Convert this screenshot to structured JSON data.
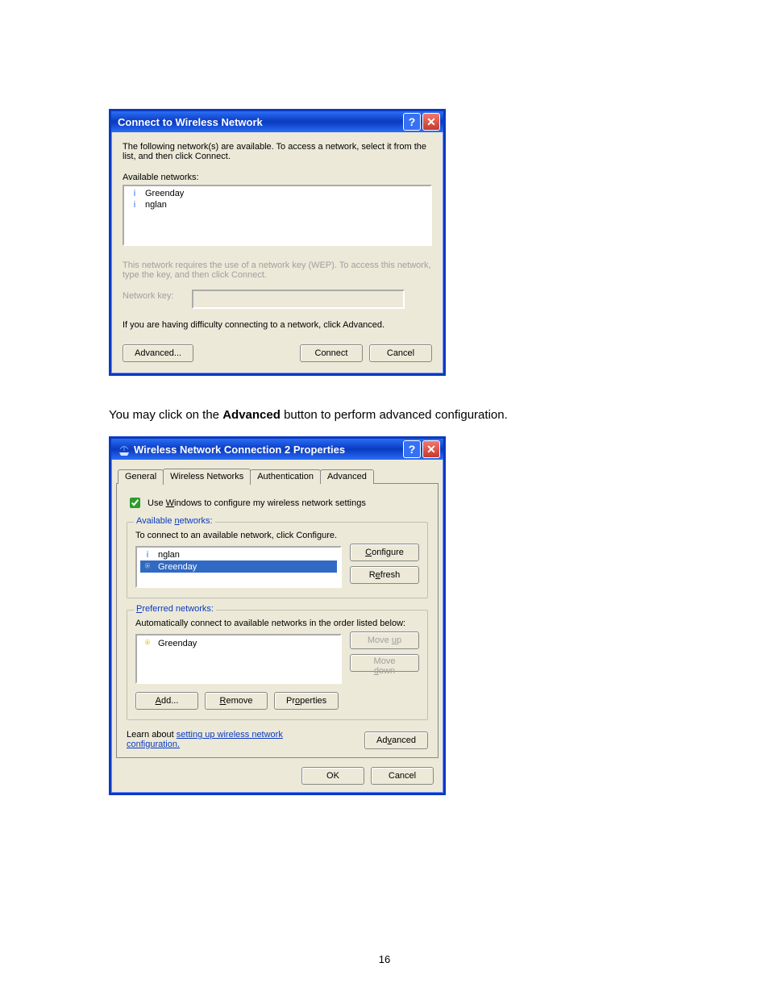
{
  "page_number": "16",
  "body_text_prefix": "You may click on the ",
  "body_text_bold": "Advanced",
  "body_text_suffix": " button to perform advanced configuration.",
  "dialog1": {
    "title": "Connect to Wireless Network",
    "intro": "The following network(s) are available. To access a network, select it from the list, and then click Connect.",
    "available_label": "Available networks:",
    "networks": [
      "Greenday",
      "nglan"
    ],
    "wep_text": "This network requires the use of a network key (WEP). To access this network, type the key, and then click Connect.",
    "key_label": "Network key:",
    "difficulty_text": "If you are having difficulty connecting to a network, click Advanced.",
    "btn_advanced": "Advanced...",
    "btn_connect": "Connect",
    "btn_cancel": "Cancel"
  },
  "dialog2": {
    "title": "Wireless Network Connection 2 Properties",
    "tabs": [
      "General",
      "Wireless Networks",
      "Authentication",
      "Advanced"
    ],
    "checkbox_label_pre": "Use ",
    "checkbox_label_u": "W",
    "checkbox_label_post": "indows to configure my wireless network settings",
    "group_available": {
      "legend_pre": "Available ",
      "legend_u": "n",
      "legend_post": "etworks:",
      "hint": "To connect to an available network, click Configure.",
      "items": [
        "nglan",
        "Greenday"
      ],
      "btn_configure": "Configure",
      "btn_refresh": "Refresh"
    },
    "group_preferred": {
      "legend_pre": "",
      "legend_u": "P",
      "legend_post": "referred networks:",
      "hint": "Automatically connect to available networks in the order listed below:",
      "items": [
        "Greenday"
      ],
      "btn_moveup": "Move up",
      "btn_movedown": "Move down",
      "btn_add": "Add...",
      "btn_remove": "Remove",
      "btn_props": "Properties"
    },
    "learn_prefix": "Learn about ",
    "learn_link": "setting up wireless network",
    "learn_link2": "configuration.",
    "btn_advanced": "Advanced",
    "btn_ok": "OK",
    "btn_cancel": "Cancel"
  }
}
